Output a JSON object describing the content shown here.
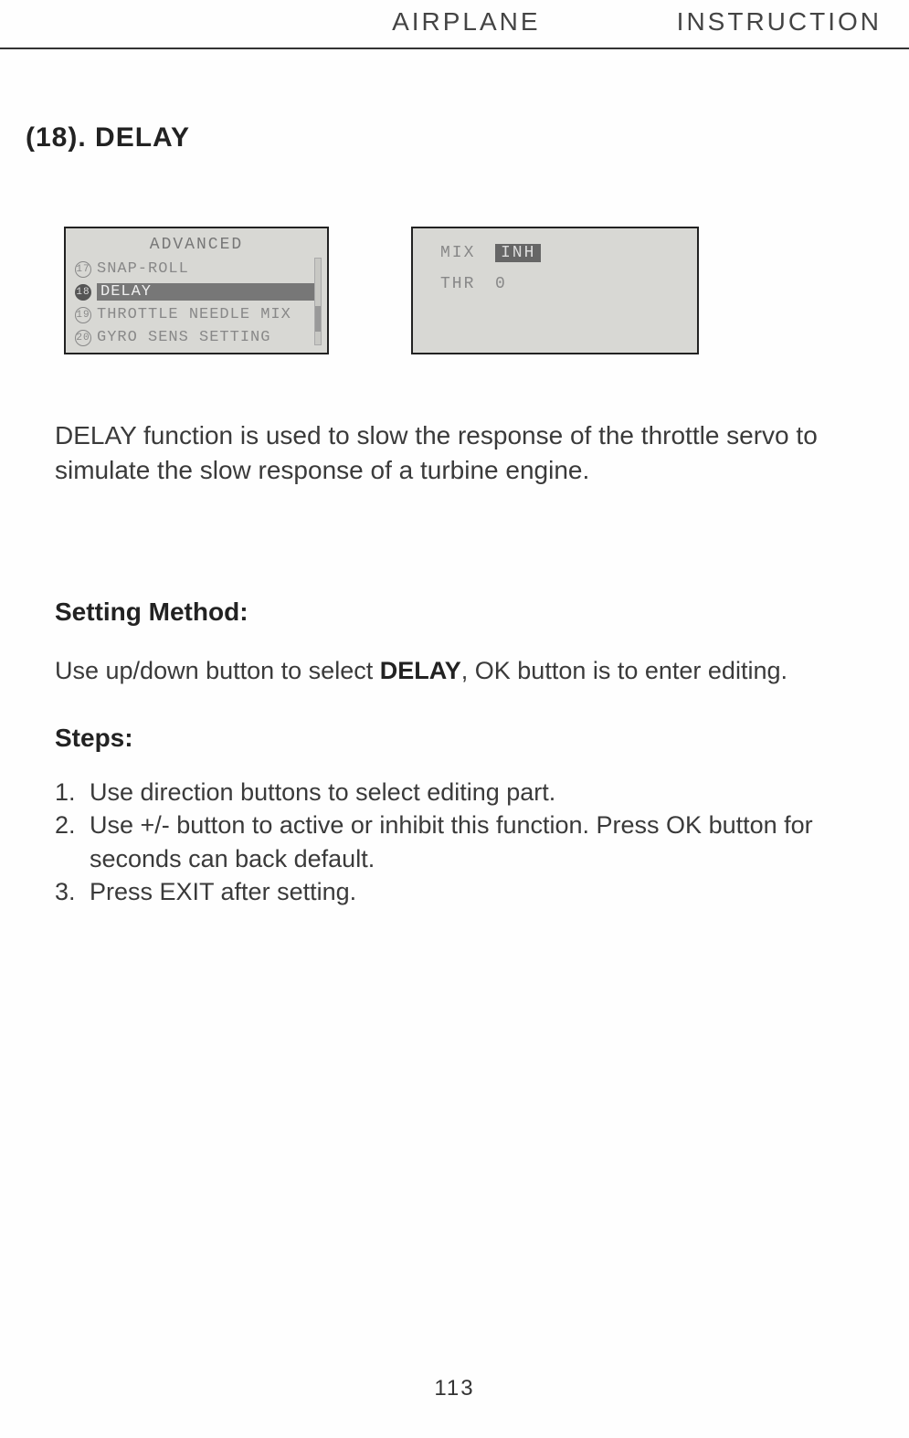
{
  "header": {
    "left": "AIRPLANE",
    "right": "INSTRUCTION"
  },
  "section": {
    "number": "(18).",
    "title": "DELAY"
  },
  "lcd_left": {
    "title": "ADVANCED",
    "items": [
      {
        "num": "17",
        "label": "SNAP-ROLL",
        "selected": false,
        "filled": false
      },
      {
        "num": "18",
        "label": "DELAY",
        "selected": true,
        "filled": true
      },
      {
        "num": "19",
        "label": "THROTTLE NEEDLE MIX",
        "selected": false,
        "filled": false
      },
      {
        "num": "20",
        "label": "GYRO SENS SETTING",
        "selected": false,
        "filled": false
      }
    ]
  },
  "lcd_right": {
    "rows": [
      {
        "label": "MIX",
        "value": "INH",
        "inverted": true
      },
      {
        "label": "THR",
        "value": "0",
        "inverted": false
      }
    ]
  },
  "description": "DELAY function is used to slow the response of the throttle servo to simulate the slow response of a turbine engine.",
  "setting_method": {
    "heading": "Setting Method:",
    "text_before": "Use up/down button to select ",
    "text_bold": "DELAY",
    "text_after": ", OK button is to enter editing."
  },
  "steps": {
    "heading": "Steps:",
    "items": [
      "Use direction buttons to select editing part.",
      "Use +/- button to active or inhibit this function. Press OK button for seconds can back default.",
      "Press EXIT after setting."
    ]
  },
  "page_number": "113"
}
